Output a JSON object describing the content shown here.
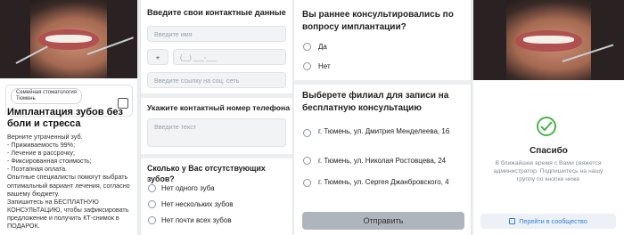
{
  "panel1": {
    "clinic_chip": "Семейная стоматология\nТюмень",
    "title": "Имплантация зубов без боли и стресса",
    "description": "Верните утраченный зуб.\n- Приживаемость 99%;\n- Лечение в рассрочку;\n- Фиксированная стоимость;\n- Поэтапная оплата.\nОпытные специалисты помогут выбрать оптимальный вариант лечения, согласно вашему бюджету.\nЗапишитесь на БЕСПЛАТНУЮ КОНСУЛЬТАЦИЮ, чтобы зафиксировать предложение и получить КТ-снимок в ПОДАРОК."
  },
  "panel2": {
    "contacts_title": "Введите свои контактные данные",
    "name_placeholder": "Введите имя",
    "phone_plus": "+",
    "phone_mask": "(__) ___-___",
    "social_placeholder": "Введите ссылку на соц. сеть",
    "phone_title": "Укажите контактный номер телефона",
    "text_placeholder": "Введите текст",
    "teeth_question": "Сколько у Вас отсутствующих зубов?",
    "teeth_options": [
      "Нет одного зуба",
      "Нет нескольких зубов",
      "Нет почти всех зубов"
    ]
  },
  "panel3": {
    "consult_question": "Вы раннее консультировались по вопросу имплантации?",
    "consult_options": [
      "Да",
      "Нет"
    ],
    "branch_question": "Выберете филиал для записи на бесплатную консультацию",
    "branch_options": [
      "г. Тюмень, ул. Дмитрия Менделеева, 16",
      "г. Тюмень, ул. Николая Ростовцева, 24",
      "г. Тюмень, ул. Сергея Джанбровского, 4"
    ],
    "send_label": "Отправить"
  },
  "panel4": {
    "thanks_title": "Спасибо",
    "thanks_text": "В ближайшее время с Вами свяжется администратор. Подпишитесь на нашу группу по кнопке ниже",
    "community_label": "Перейти в сообщество"
  },
  "colors": {
    "accent": "#2d81e0",
    "success": "#4bb34b",
    "button_disabled": "#aeb5bd"
  }
}
